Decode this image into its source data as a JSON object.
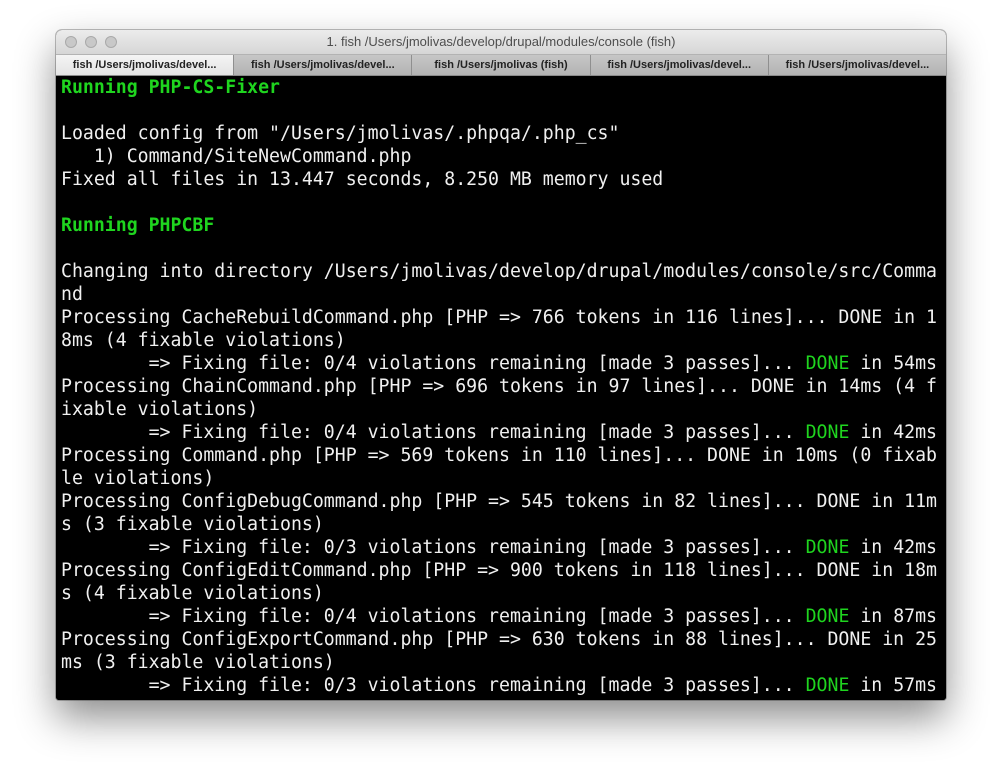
{
  "window": {
    "title": "1. fish  /Users/jmolivas/develop/drupal/modules/console (fish)"
  },
  "tabs": [
    {
      "label": "fish  /Users/jmolivas/devel..."
    },
    {
      "label": "fish  /Users/jmolivas/devel..."
    },
    {
      "label": "fish  /Users/jmolivas (fish)"
    },
    {
      "label": "fish  /Users/jmolivas/devel..."
    },
    {
      "label": "fish  /Users/jmolivas/devel..."
    }
  ],
  "colors": {
    "background": "#000000",
    "foreground": "#f0f0f0",
    "green": "#1fd51f"
  },
  "terminal": {
    "l01": "Running PHP-CS-Fixer",
    "l02": "",
    "l03": "Loaded config from \"/Users/jmolivas/.phpqa/.php_cs\"",
    "l04": "   1) Command/SiteNewCommand.php",
    "l05": "Fixed all files in 13.447 seconds, 8.250 MB memory used",
    "l06": "",
    "l07": "Running PHPCBF",
    "l08": "",
    "l09": "Changing into directory /Users/jmolivas/develop/drupal/modules/console/src/Comma",
    "l10": "nd",
    "l11": "Processing CacheRebuildCommand.php [PHP => 766 tokens in 116 lines]... DONE in 1",
    "l12": "8ms (4 fixable violations)",
    "l13a": "        => Fixing file: 0/4 violations remaining [made 3 passes]... ",
    "l13b": "DONE",
    "l13c": " in 54ms",
    "l14": "Processing ChainCommand.php [PHP => 696 tokens in 97 lines]... DONE in 14ms (4 f",
    "l15": "ixable violations)",
    "l16a": "        => Fixing file: 0/4 violations remaining [made 3 passes]... ",
    "l16b": "DONE",
    "l16c": " in 42ms",
    "l17": "Processing Command.php [PHP => 569 tokens in 110 lines]... DONE in 10ms (0 fixab",
    "l18": "le violations)",
    "l19": "Processing ConfigDebugCommand.php [PHP => 545 tokens in 82 lines]... DONE in 11m",
    "l20": "s (3 fixable violations)",
    "l21a": "        => Fixing file: 0/3 violations remaining [made 3 passes]... ",
    "l21b": "DONE",
    "l21c": " in 42ms",
    "l22": "Processing ConfigEditCommand.php [PHP => 900 tokens in 118 lines]... DONE in 18m",
    "l23": "s (4 fixable violations)",
    "l24a": "        => Fixing file: 0/4 violations remaining [made 3 passes]... ",
    "l24b": "DONE",
    "l24c": " in 87ms",
    "l25": "Processing ConfigExportCommand.php [PHP => 630 tokens in 88 lines]... DONE in 25",
    "l26": "ms (3 fixable violations)",
    "l27a": "        => Fixing file: 0/3 violations remaining [made 3 passes]... ",
    "l27b": "DONE",
    "l27c": " in 57ms"
  }
}
